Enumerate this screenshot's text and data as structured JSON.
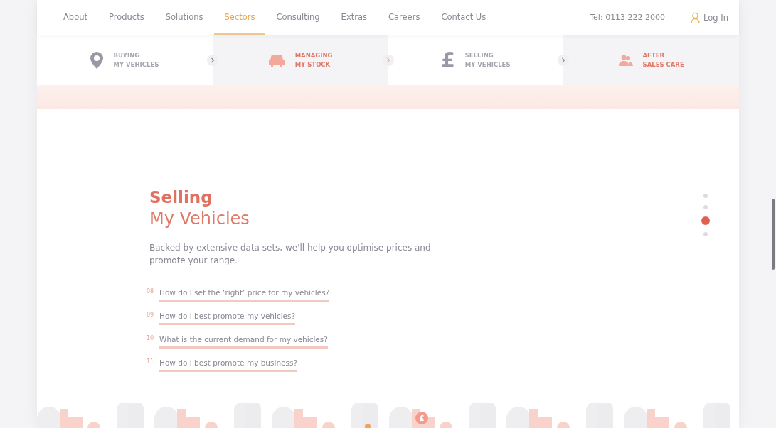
{
  "nav": {
    "items": [
      {
        "label": "About",
        "selected": false
      },
      {
        "label": "Products",
        "selected": false
      },
      {
        "label": "Solutions",
        "selected": false
      },
      {
        "label": "Sectors",
        "selected": true
      },
      {
        "label": "Consulting",
        "selected": false
      },
      {
        "label": "Extras",
        "selected": false
      },
      {
        "label": "Careers",
        "selected": false
      },
      {
        "label": "Contact Us",
        "selected": false
      }
    ],
    "phone": "Tel: 0113 222 2000",
    "login": "Log In"
  },
  "steps": [
    {
      "kind": "pin",
      "line1": "BUYING",
      "line2": "MY VEHICLES",
      "highlighted": false
    },
    {
      "kind": "car",
      "line1": "MANAGING",
      "line2": "MY STOCK",
      "highlighted": true
    },
    {
      "kind": "symbol",
      "symbol": "£",
      "line1": "SELLING",
      "line2": "MY VEHICLES",
      "highlighted": false
    },
    {
      "kind": "people",
      "line1": "AFTER",
      "line2": "SALES CARE",
      "highlighted": true
    }
  ],
  "section": {
    "title": "Selling",
    "subtitle": "My Vehicles",
    "intro": "Backed by extensive data sets, we'll help you optimise prices and promote your range.",
    "questions": [
      {
        "number": "08",
        "text": "How do I set the ‘right’ price for my vehicles?"
      },
      {
        "number": "09",
        "text": "How do I best promote my vehicles?"
      },
      {
        "number": "10",
        "text": "What is the current demand for my vehicles?"
      },
      {
        "number": "11",
        "text": "How do I best promote my business?"
      }
    ]
  },
  "pager": [
    {
      "selected": false
    },
    {
      "selected": false
    },
    {
      "selected": true
    },
    {
      "selected": false
    }
  ],
  "footer": {
    "pin_symbol": "£"
  }
}
